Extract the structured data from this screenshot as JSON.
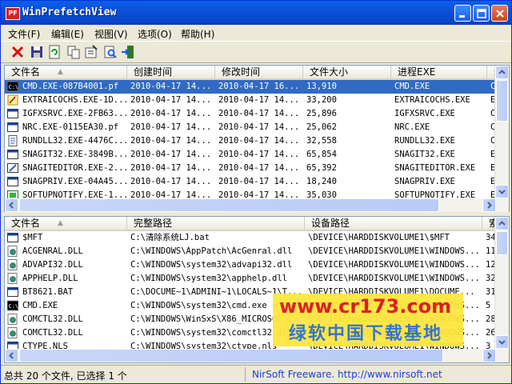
{
  "window": {
    "title": "WinPrefetchView",
    "icon_label": "PF",
    "minimize": "minimize",
    "maximize": "maximize",
    "close": "close"
  },
  "menu": [
    {
      "label": "文件(F)"
    },
    {
      "label": "编辑(E)"
    },
    {
      "label": "视图(V)"
    },
    {
      "label": "选项(O)"
    },
    {
      "label": "帮助(H)"
    }
  ],
  "toolbar": [
    "delete-icon",
    "save-icon",
    "refresh-icon",
    "copy-icon",
    "properties-icon",
    "find-icon",
    "exit-icon"
  ],
  "top_table": {
    "columns": [
      "文件名",
      "创建时间",
      "修改时间",
      "文件大小",
      "进程EXE",
      "进"
    ],
    "rows": [
      {
        "icon": "cmd",
        "name": "CMD.EXE-087B4001.pf",
        "created": "2010-04-17 14...",
        "modified": "2010-04-17 16...",
        "size": "13,910",
        "exe": "CMD.EXE",
        "extra": "C",
        "selected": true
      },
      {
        "icon": "pen",
        "name": "EXTRAICOCHS.EXE-1D...",
        "created": "2010-04-17 14...",
        "modified": "2010-04-17 14...",
        "size": "33,200",
        "exe": "EXTRAICOCHS.EXE",
        "extra": "E"
      },
      {
        "icon": "win",
        "name": "IGFXSRVC.EXE-2FB63...",
        "created": "2010-04-17 14...",
        "modified": "2010-04-17 14...",
        "size": "25,896",
        "exe": "IGFXSRVC.EXE",
        "extra": "C"
      },
      {
        "icon": "win",
        "name": "NRC.EXE-0115EA30.pf",
        "created": "2010-04-17 14...",
        "modified": "2010-04-17 14...",
        "size": "25,062",
        "exe": "NRC.EXE",
        "extra": "C"
      },
      {
        "icon": "doc",
        "name": "RUNDLL32.EXE-4476C...",
        "created": "2010-04-17 14...",
        "modified": "2010-04-17 14...",
        "size": "32,558",
        "exe": "RUNDLL32.EXE",
        "extra": "C"
      },
      {
        "icon": "win",
        "name": "SNAGIT32.EXE-3849B...",
        "created": "2010-04-17 14...",
        "modified": "2010-04-17 14...",
        "size": "65,854",
        "exe": "SNAGIT32.EXE",
        "extra": "E"
      },
      {
        "icon": "edit",
        "name": "SNAGITEDITOR.EXE-2...",
        "created": "2010-04-17 14...",
        "modified": "2010-04-17 14...",
        "size": "65,392",
        "exe": "SNAGITEDITOR.EXE",
        "extra": "E"
      },
      {
        "icon": "win",
        "name": "SNAGPRIV.EXE-04A45...",
        "created": "2010-04-17 14...",
        "modified": "2010-04-17 14...",
        "size": "18,240",
        "exe": "SNAGPRIV.EXE",
        "extra": "E"
      },
      {
        "icon": "green",
        "name": "SOFTUPNOTIFY.EXE-1...",
        "created": "2010-04-17 14...",
        "modified": "2010-04-17 14...",
        "size": "35,030",
        "exe": "SOFTUPNOTIFY.EXE",
        "extra": "E"
      }
    ]
  },
  "bottom_table": {
    "columns": [
      "文件名",
      "完整路径",
      "设备路径",
      "索"
    ],
    "rows": [
      {
        "icon": "win",
        "name": "$MFT",
        "path": "C:\\清除系统LJ.bat",
        "device": "\\DEVICE\\HARDDISKVOLUME1\\$MFT",
        "idx": "34"
      },
      {
        "icon": "gear",
        "name": "ACGENRAL.DLL",
        "path": "C:\\WINDOWS\\AppPatch\\AcGenral.dll",
        "device": "\\DEVICE\\HARDDISKVOLUME1\\WINDOWS...",
        "idx": "11"
      },
      {
        "icon": "gear",
        "name": "ADVAPI32.DLL",
        "path": "C:\\WINDOWS\\system32\\advapi32.dll",
        "device": "\\DEVICE\\HARDDISKVOLUME1\\WINDOWS...",
        "idx": "12"
      },
      {
        "icon": "gear",
        "name": "APPHELP.DLL",
        "path": "C:\\WINDOWS\\system32\\apphelp.dll",
        "device": "\\DEVICE\\HARDDISKVOLUME1\\WINDOWS...",
        "idx": "32"
      },
      {
        "icon": "win",
        "name": "BT8621.BAT",
        "path": "C:\\DOCUME~1\\ADMINI~1\\LOCALS~1\\T...",
        "device": "\\DEVICE\\HARDDISKVOLUME1\\DOCUME...",
        "idx": "31"
      },
      {
        "icon": "cmd",
        "name": "CMD.EXE",
        "path": "C:\\WINDOWS\\system32\\cmd.exe",
        "device": "\\DEVICE\\HARDDISKVOLUME1\\WINDOWS...",
        "idx": "5"
      },
      {
        "icon": "gear",
        "name": "COMCTL32.DLL",
        "path": "C:\\WINDOWS\\WinSxS\\X86_MICROSOF...",
        "device": "\\DEVICE\\HARDDISKVOLUME1\\WINDOWS...",
        "idx": "28"
      },
      {
        "icon": "gear",
        "name": "COMCTL32.DLL",
        "path": "C:\\WINDOWS\\system32\\comctl32.dll",
        "device": "\\DEVICE\\HARDDISKVOLUME1\\WINDOWS...",
        "idx": "26"
      },
      {
        "icon": "win",
        "name": "CTYPE.NLS",
        "path": "C:\\WINDOWS\\system32\\ctype.nls",
        "device": "\\DEVICE\\HARDDISKVOLUME1\\WINDOWS...",
        "idx": "3"
      }
    ]
  },
  "status": {
    "left": "总共 20 个文件, 已选择 1 个",
    "right": "NirSoft Freeware.  http://www.nirsoft.net"
  },
  "watermark": {
    "url": "www.cr173.com",
    "cn": "绿软中国下载基地"
  },
  "colors": {
    "titlebar": "#0A5FE8",
    "selection": "#316AC5",
    "status_link": "#1C3FD4",
    "watermark_bg": "#FFE640"
  }
}
